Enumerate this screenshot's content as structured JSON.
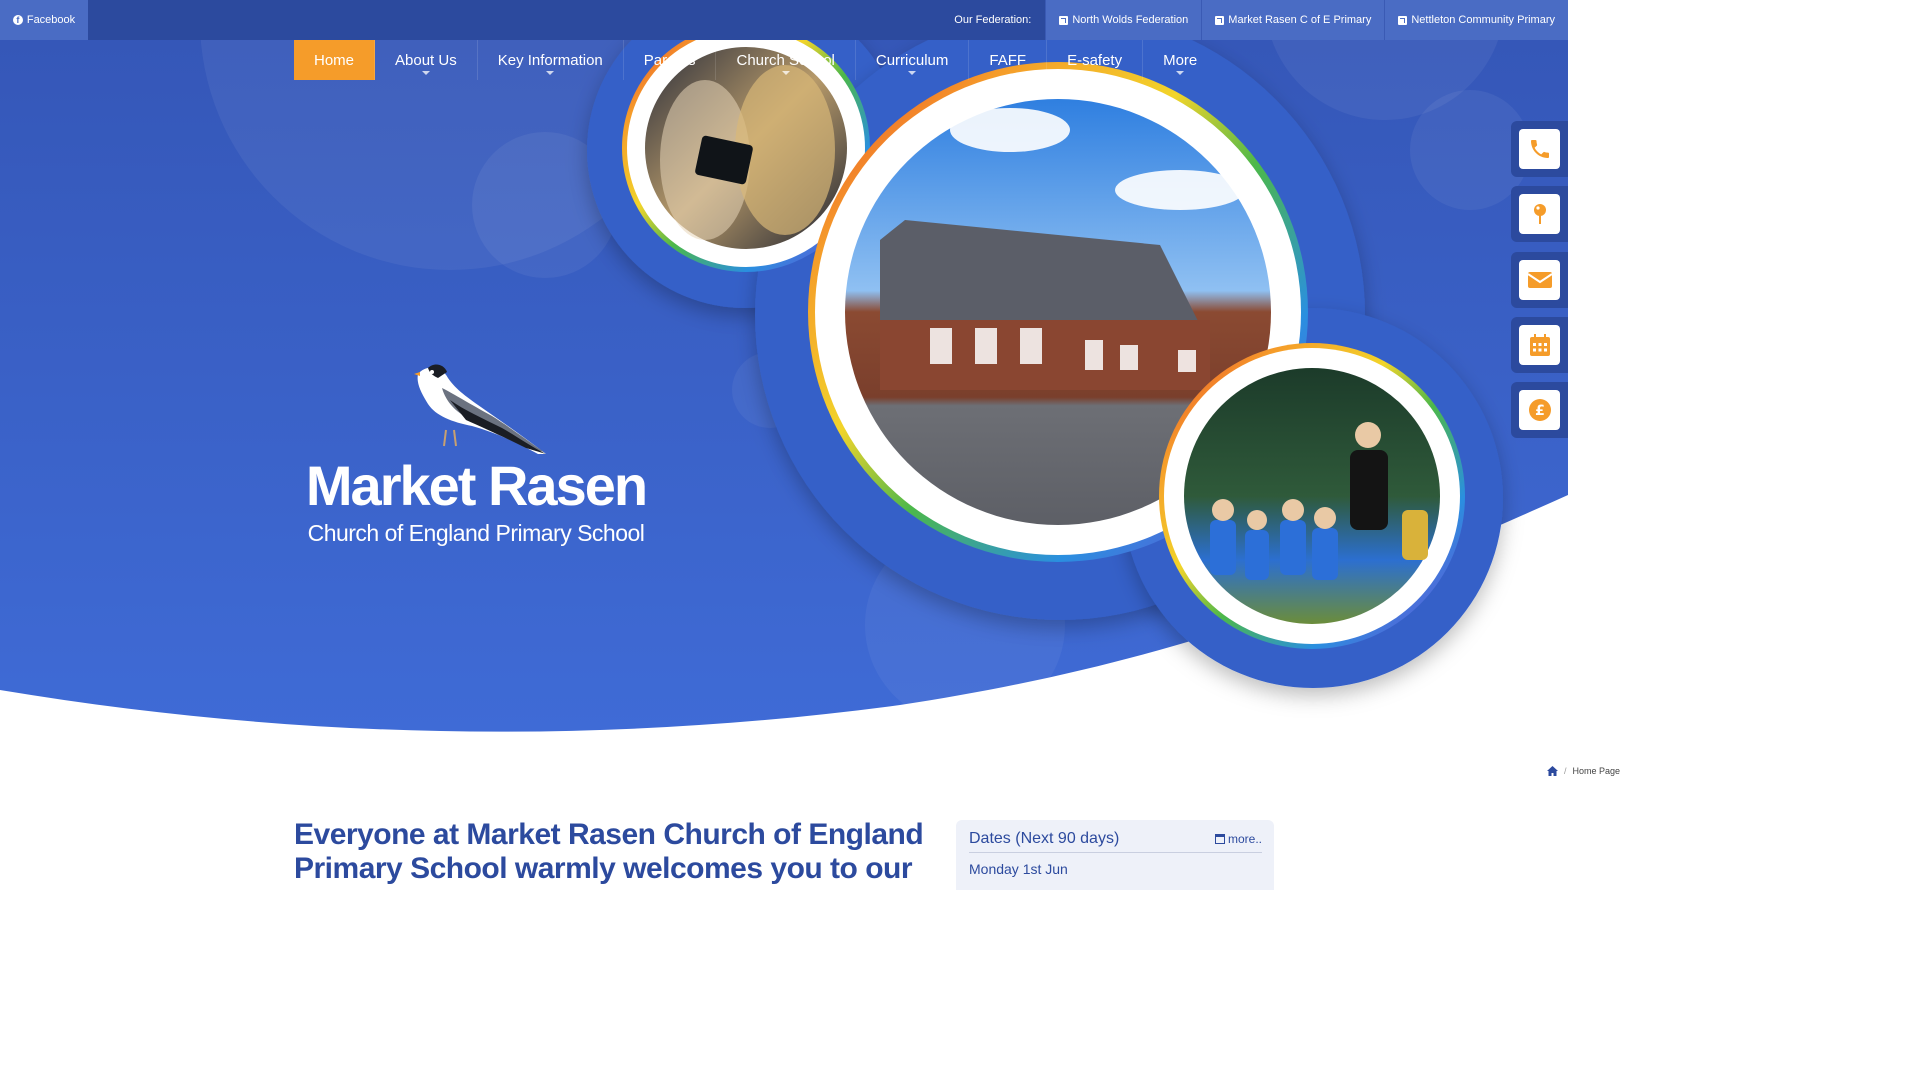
{
  "topbar": {
    "facebook_label": "Facebook",
    "federation_label": "Our Federation:",
    "federation_links": [
      {
        "label": "North Wolds Federation"
      },
      {
        "label": "Market Rasen C of E Primary"
      },
      {
        "label": "Nettleton Community Primary"
      }
    ]
  },
  "nav": {
    "items": [
      {
        "label": "Home",
        "active": true
      },
      {
        "label": "About Us",
        "has_submenu": true
      },
      {
        "label": "Key Information",
        "has_submenu": true
      },
      {
        "label": "Parents",
        "has_submenu": true
      },
      {
        "label": "Church School",
        "has_submenu": true
      },
      {
        "label": "Curriculum",
        "has_submenu": true
      },
      {
        "label": "FAFF"
      },
      {
        "label": "E-safety"
      },
      {
        "label": "More",
        "has_submenu": true
      }
    ]
  },
  "logo": {
    "title": "Market Rasen",
    "subtitle": "Church of England Primary School"
  },
  "side_links": [
    {
      "icon": "phone-icon"
    },
    {
      "icon": "map-pin-icon"
    },
    {
      "icon": "envelope-icon"
    },
    {
      "icon": "calendar-icon"
    },
    {
      "icon": "pound-icon"
    }
  ],
  "breadcrumb": {
    "items": [
      "Home Page"
    ]
  },
  "main": {
    "welcome_heading": "Everyone at Market Rasen Church of England Primary School warmly welcomes you to our"
  },
  "dates": {
    "title": "Dates (Next 90 days)",
    "more_label": "more..",
    "items": [
      {
        "date": "Monday 1st Jun"
      }
    ]
  },
  "colors": {
    "primary": "#2c4a9e",
    "hero": "#3a63cc",
    "accent": "#f59c2a"
  }
}
